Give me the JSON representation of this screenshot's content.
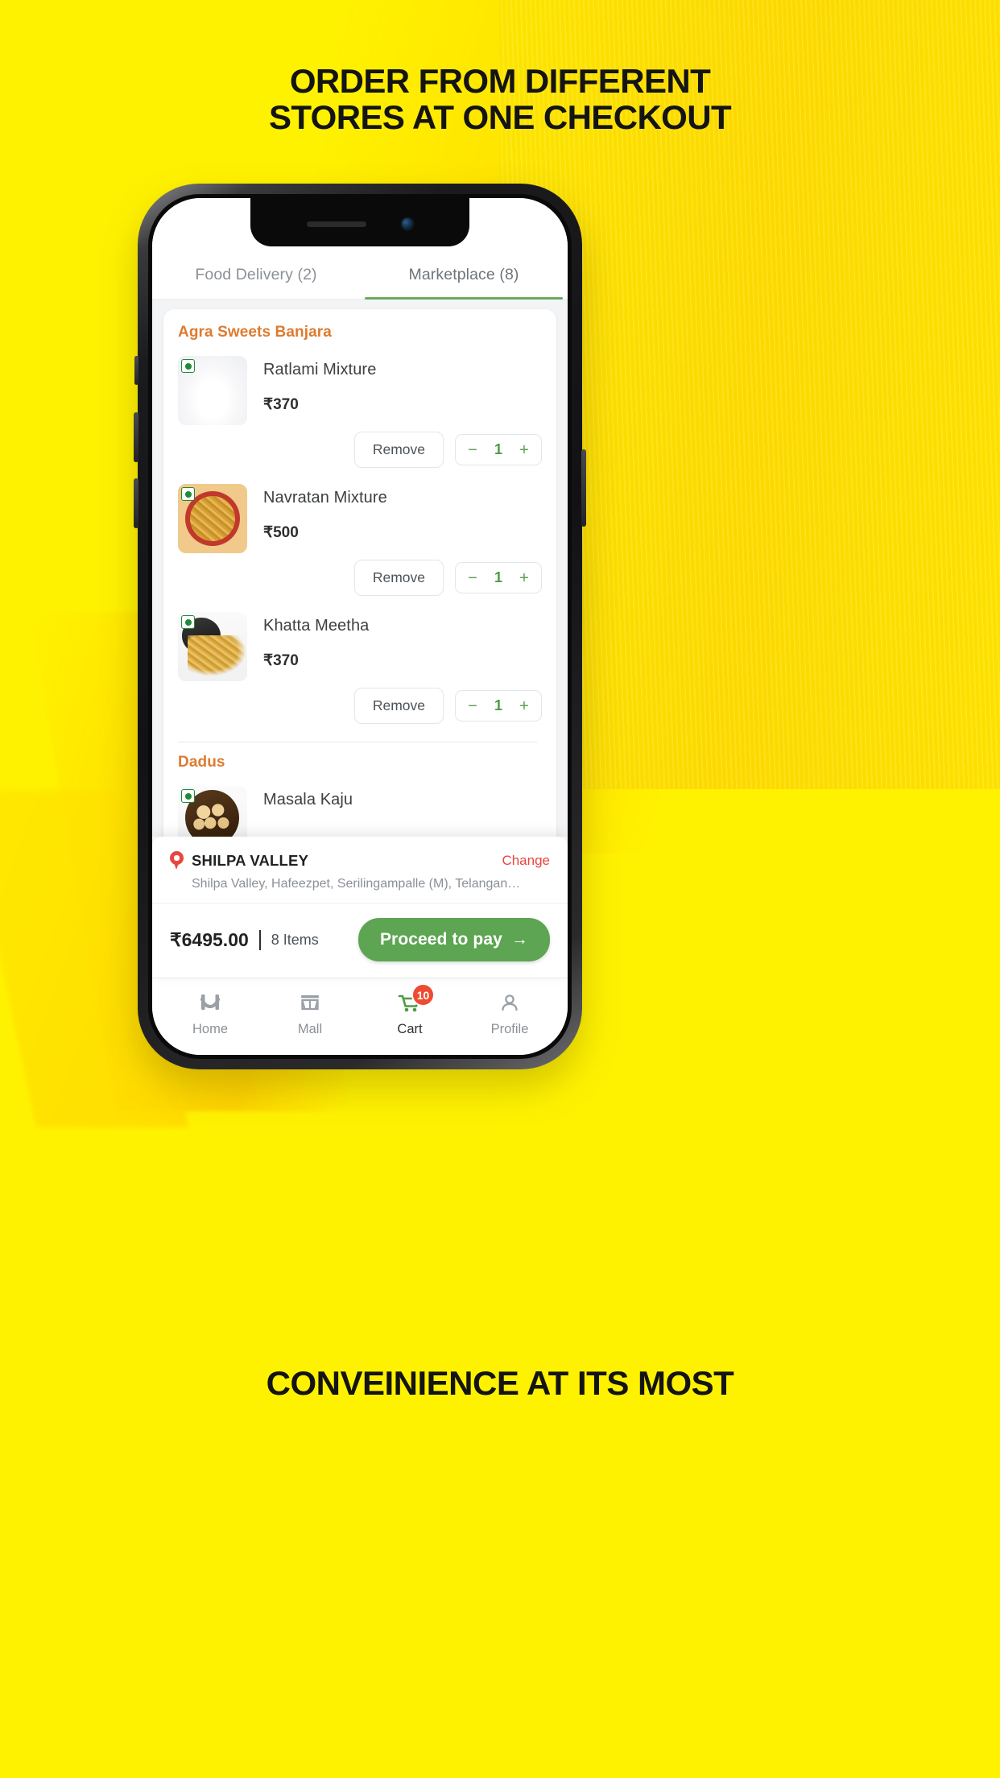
{
  "promo": {
    "headline_line1": "ORDER FROM DIFFERENT",
    "headline_line2": "STORES AT ONE CHECKOUT",
    "footline": "CONVEINIENCE AT ITS MOST",
    "background_color": "#FFF200"
  },
  "app": {
    "tabs": [
      {
        "label": "Food Delivery (2)",
        "active": false
      },
      {
        "label": "Marketplace (8)",
        "active": true
      }
    ],
    "accent_green": "#5DA552",
    "store_name_color": "#DD7B30",
    "stores": [
      {
        "name": "Agra Sweets Banjara",
        "items": [
          {
            "name": "Ratlami Mixture",
            "price": "₹370",
            "veg": true,
            "remove_label": "Remove",
            "qty": "1",
            "minus": "−",
            "plus": "+",
            "image": "ratlami-mixture-photo"
          },
          {
            "name": "Navratan Mixture",
            "price": "₹500",
            "veg": true,
            "remove_label": "Remove",
            "qty": "1",
            "minus": "−",
            "plus": "+",
            "image": "navratan-mixture-photo"
          },
          {
            "name": "Khatta Meetha",
            "price": "₹370",
            "veg": true,
            "remove_label": "Remove",
            "qty": "1",
            "minus": "−",
            "plus": "+",
            "image": "khatta-meetha-photo"
          }
        ]
      },
      {
        "name": "Dadus",
        "items": [
          {
            "name": "Masala Kaju",
            "veg": true,
            "image": "masala-kaju-photo"
          }
        ]
      }
    ],
    "address": {
      "title": "SHILPA VALLEY",
      "change_label": "Change",
      "detail": "Shilpa Valley, Hafeezpet, Serilingampalle (M), Telangan…",
      "pin_color": "#E8473F"
    },
    "checkout": {
      "total": "₹6495.00",
      "items_count": "8 Items",
      "pay_label": "Proceed to pay",
      "pay_arrow": "→"
    },
    "bottom_nav": [
      {
        "label": "Home",
        "icon": "hammock-home-icon",
        "active": false
      },
      {
        "label": "Mall",
        "icon": "storefront-icon",
        "active": false
      },
      {
        "label": "Cart",
        "icon": "shopping-cart-icon",
        "active": true,
        "badge": "10"
      },
      {
        "label": "Profile",
        "icon": "person-icon",
        "active": false
      }
    ]
  }
}
